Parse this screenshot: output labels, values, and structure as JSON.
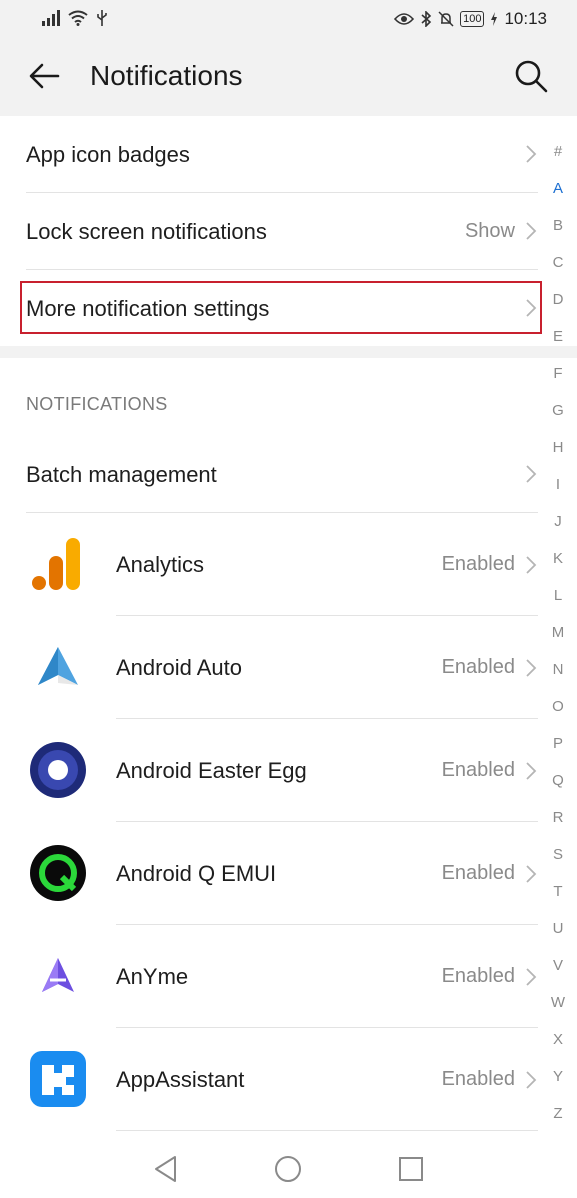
{
  "status_bar": {
    "battery": "100",
    "time": "10:13"
  },
  "header": {
    "title": "Notifications"
  },
  "settings": [
    {
      "label": "App icon badges",
      "value": ""
    },
    {
      "label": "Lock screen notifications",
      "value": "Show"
    },
    {
      "label": "More notification settings",
      "value": ""
    }
  ],
  "section": {
    "heading": "NOTIFICATIONS",
    "batch_label": "Batch management"
  },
  "apps": [
    {
      "name": "Analytics",
      "status": "Enabled",
      "icon": "analytics-icon"
    },
    {
      "name": "Android Auto",
      "status": "Enabled",
      "icon": "android-auto-icon"
    },
    {
      "name": "Android Easter Egg",
      "status": "Enabled",
      "icon": "android-easter-egg-icon"
    },
    {
      "name": "Android Q EMUI",
      "status": "Enabled",
      "icon": "android-q-emui-icon"
    },
    {
      "name": "AnYme",
      "status": "Enabled",
      "icon": "anyme-icon"
    },
    {
      "name": "AppAssistant",
      "status": "Enabled",
      "icon": "appassistant-icon"
    }
  ],
  "alphabet": [
    "#",
    "A",
    "B",
    "C",
    "D",
    "E",
    "F",
    "G",
    "H",
    "I",
    "J",
    "K",
    "L",
    "M",
    "N",
    "O",
    "P",
    "Q",
    "R",
    "S",
    "T",
    "U",
    "V",
    "W",
    "X",
    "Y",
    "Z"
  ],
  "alphabet_active": "A",
  "colors": {
    "accent": "#1c6fd1",
    "highlight": "#c8202e"
  }
}
